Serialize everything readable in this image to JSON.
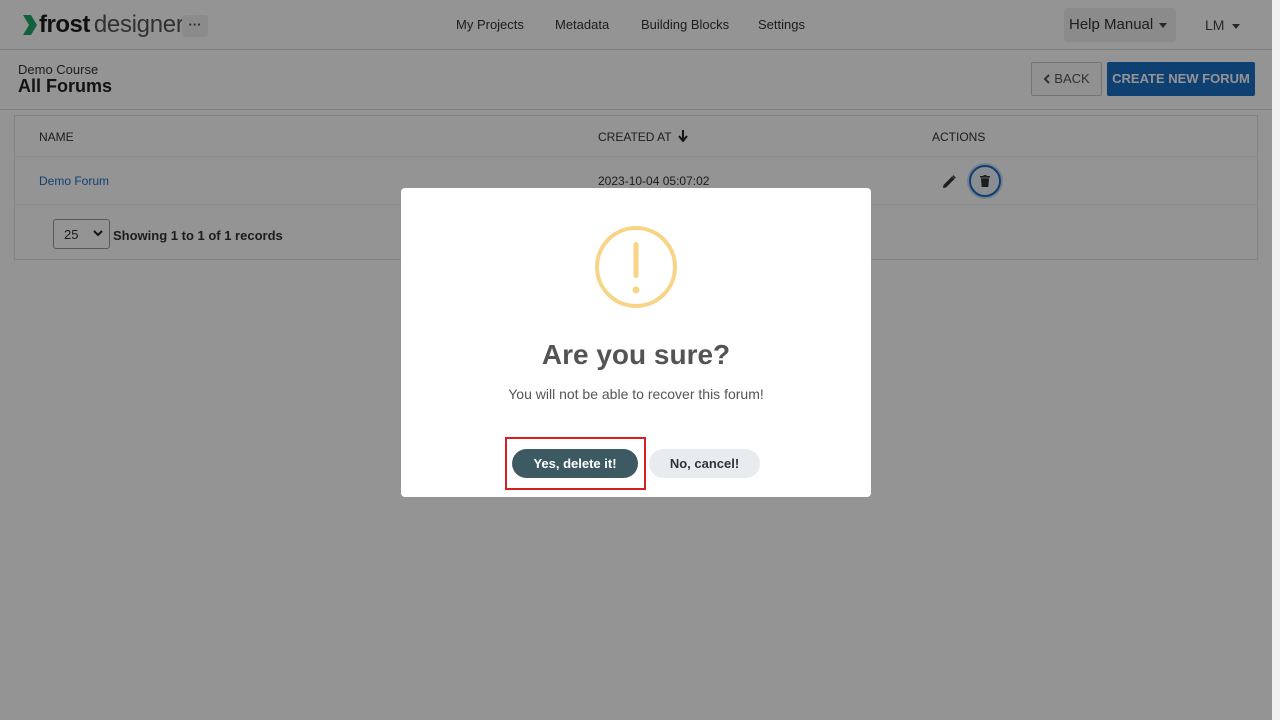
{
  "brand": {
    "name_bold": "frost",
    "name_light": "designer",
    "more": "···"
  },
  "nav": {
    "items": [
      "My Projects",
      "Metadata",
      "Building Blocks",
      "Settings"
    ]
  },
  "help": {
    "label": "Help Manual"
  },
  "user": {
    "initials": "LM"
  },
  "header": {
    "course": "Demo Course",
    "title": "All Forums",
    "back_label": "BACK",
    "create_label": "CREATE NEW FORUM"
  },
  "table": {
    "columns": [
      "NAME",
      "CREATED AT",
      "ACTIONS"
    ],
    "rows": [
      {
        "name": "Demo Forum",
        "created_at": "2023-10-04 05:07:02"
      }
    ],
    "page_size": "25",
    "records_text": "Showing 1 to 1 of 1 records"
  },
  "modal": {
    "title": "Are you sure?",
    "text": "You will not be able to recover this forum!",
    "confirm_label": "Yes, delete it!",
    "cancel_label": "No, cancel!"
  },
  "colors": {
    "brand_green": "#1fa86b",
    "primary_blue": "#1a6fc4",
    "warning": "#f8d486",
    "confirm": "#3d5962"
  }
}
